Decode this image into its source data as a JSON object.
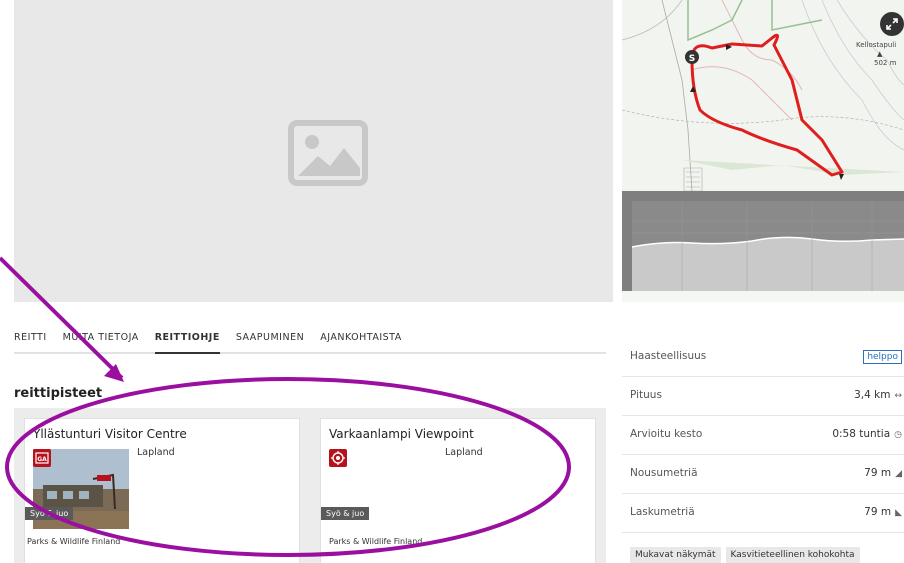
{
  "hero": {
    "icon": "image-placeholder-icon"
  },
  "map": {
    "peak_name": "Kellostapuli",
    "peak_elevation": "502 m",
    "start_marker": "S",
    "route_color": "#e01e1e",
    "expand_icon": "expand-icon"
  },
  "tabs": [
    {
      "label": "REITTI",
      "active": false
    },
    {
      "label": "MUITA TIETOJA",
      "active": false
    },
    {
      "label": "REITTIOHJE",
      "active": true
    },
    {
      "label": "SAAPUMINEN",
      "active": false
    },
    {
      "label": "AJANKOHTAISTA",
      "active": false
    }
  ],
  "waypoints": {
    "title": "reittipisteet",
    "cards": [
      {
        "title": "Yllästunturi Visitor Centre",
        "region": "Lapland",
        "badge": "Syö & juo",
        "org": "Parks & Wildlife Finland",
        "icon": "visitor-centre-icon"
      },
      {
        "title": "Varkaanlampi Viewpoint",
        "region": "Lapland",
        "badge": "Syö & juo",
        "org": "Parks & Wildlife Finland",
        "icon": "viewpoint-icon"
      }
    ]
  },
  "stats": [
    {
      "label": "Haasteellisuus",
      "value": "helppo",
      "icon": ""
    },
    {
      "label": "Pituus",
      "value": "3,4 km",
      "icon": "↔"
    },
    {
      "label": "Arvioitu kesto",
      "value": "0:58 tuntia",
      "icon": "◷"
    },
    {
      "label": "Nousumetriä",
      "value": "79 m",
      "icon": "◢"
    },
    {
      "label": "Laskumetriä",
      "value": "79 m",
      "icon": "◣"
    }
  ],
  "tags": [
    "Mukavat näkymät",
    "Kasvitieteellinen kohokohta"
  ],
  "colors": {
    "annotation": "#9b0fa0",
    "difficulty": "#2a6ebd",
    "icon_red": "#b5121b"
  }
}
